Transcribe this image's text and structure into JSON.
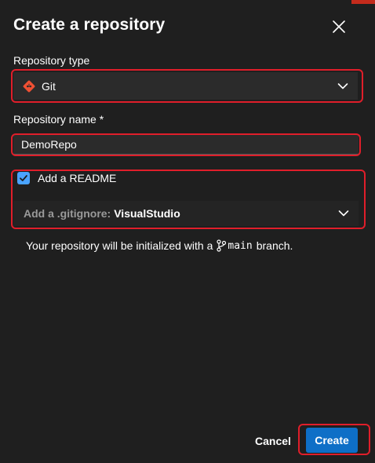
{
  "dialog": {
    "title": "Create a repository",
    "close_icon": "close-icon"
  },
  "repo_type": {
    "label": "Repository type",
    "value": "Git",
    "icon": "git-icon"
  },
  "repo_name": {
    "label": "Repository name *",
    "value": "DemoRepo"
  },
  "readme": {
    "label": "Add a README",
    "checked": true
  },
  "gitignore": {
    "prefix": "Add a .gitignore:",
    "value": "VisualStudio"
  },
  "info": {
    "prefix": "Your repository will be initialized with a",
    "branch": "main",
    "suffix": "branch."
  },
  "actions": {
    "cancel_label": "Cancel",
    "create_label": "Create"
  },
  "colors": {
    "background": "#1f1f1f",
    "primary": "#0e6fc7",
    "checkbox": "#4aa3ff",
    "git_brand": "#f05033",
    "highlight": "#e01e2a"
  }
}
